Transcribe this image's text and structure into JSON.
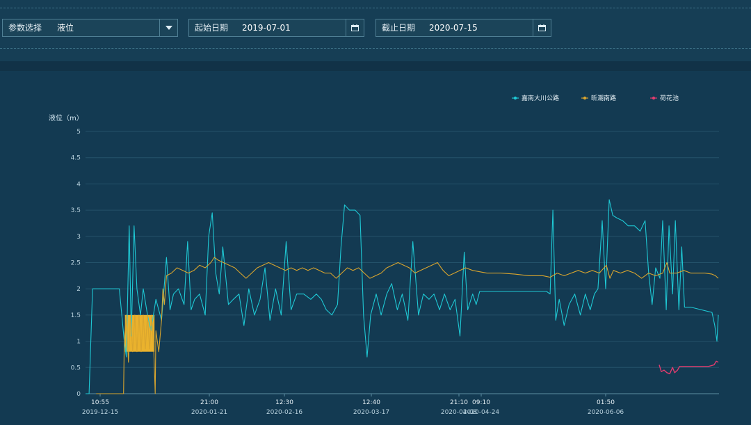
{
  "filters": {
    "param": {
      "label": "参数选择",
      "value": "液位"
    },
    "start": {
      "label": "起始日期",
      "value": "2019-07-01"
    },
    "end": {
      "label": "截止日期",
      "value": "2020-07-15"
    }
  },
  "icons": {
    "dropdown": "chevron-down-icon",
    "calendar": "calendar-icon"
  },
  "colors": {
    "page_bg": "#133a52",
    "series1": "#1fc8d4",
    "series2": "#d9a52e",
    "series3": "#e03c6e",
    "fill_block": "#f5b82b"
  },
  "chart_data": {
    "type": "line",
    "ylabel": "液位（m）",
    "ylim": [
      0,
      5
    ],
    "y_ticks": [
      "0",
      "0.5",
      "1",
      "1.5",
      "2",
      "2.5",
      "3",
      "3.5",
      "4",
      "4.5",
      "5"
    ],
    "x_ticks": [
      {
        "time": "10:55",
        "date": "2019-12-15"
      },
      {
        "time": "21:00",
        "date": "2020-01-21"
      },
      {
        "time": "12:30",
        "date": "2020-02-16"
      },
      {
        "time": "12:40",
        "date": "2020-03-17"
      },
      {
        "time": "21:10",
        "date": "2020-04-08"
      },
      {
        "time": "09:10",
        "date": "2020-04-24"
      },
      {
        "time": "01:50",
        "date": "2020-06-06"
      }
    ],
    "legend_position": "top-right",
    "grid": true,
    "series": [
      {
        "name": "嘉南大川公路",
        "color": "#1fc8d4",
        "points": [
          [
            0.0,
            0.0
          ],
          [
            0.5,
            0.0
          ],
          [
            1.0,
            2.0
          ],
          [
            2.0,
            2.0
          ],
          [
            4.8,
            2.0
          ],
          [
            5.5,
            1.0
          ],
          [
            5.8,
            0.7
          ],
          [
            6.2,
            3.2
          ],
          [
            6.5,
            1.1
          ],
          [
            6.9,
            3.2
          ],
          [
            7.3,
            2.0
          ],
          [
            7.8,
            1.5
          ],
          [
            8.2,
            2.0
          ],
          [
            8.8,
            1.5
          ],
          [
            9.3,
            1.2
          ],
          [
            10.0,
            1.8
          ],
          [
            10.8,
            1.4
          ],
          [
            11.5,
            2.6
          ],
          [
            12.0,
            1.6
          ],
          [
            12.5,
            1.9
          ],
          [
            13.2,
            2.0
          ],
          [
            14.0,
            1.7
          ],
          [
            14.5,
            2.9
          ],
          [
            15.0,
            1.6
          ],
          [
            15.5,
            1.8
          ],
          [
            16.2,
            1.9
          ],
          [
            17.0,
            1.5
          ],
          [
            17.5,
            3.0
          ],
          [
            18.0,
            3.45
          ],
          [
            18.5,
            2.3
          ],
          [
            19.0,
            1.9
          ],
          [
            19.5,
            2.8
          ],
          [
            20.3,
            1.7
          ],
          [
            21.0,
            1.8
          ],
          [
            21.8,
            1.9
          ],
          [
            22.5,
            1.3
          ],
          [
            23.2,
            2.0
          ],
          [
            24.0,
            1.5
          ],
          [
            24.8,
            1.8
          ],
          [
            25.5,
            2.4
          ],
          [
            26.2,
            1.4
          ],
          [
            27.0,
            2.0
          ],
          [
            27.8,
            1.5
          ],
          [
            28.5,
            2.9
          ],
          [
            29.2,
            1.6
          ],
          [
            30.0,
            1.9
          ],
          [
            31.0,
            1.9
          ],
          [
            32.0,
            1.8
          ],
          [
            32.8,
            1.9
          ],
          [
            33.5,
            1.8
          ],
          [
            34.2,
            1.6
          ],
          [
            35.0,
            1.5
          ],
          [
            35.8,
            1.7
          ],
          [
            36.3,
            2.8
          ],
          [
            36.8,
            3.6
          ],
          [
            37.5,
            3.5
          ],
          [
            38.3,
            3.5
          ],
          [
            39.0,
            3.4
          ],
          [
            39.5,
            1.5
          ],
          [
            40.0,
            0.7
          ],
          [
            40.5,
            1.5
          ],
          [
            41.3,
            1.9
          ],
          [
            42.0,
            1.5
          ],
          [
            42.8,
            1.9
          ],
          [
            43.5,
            2.1
          ],
          [
            44.3,
            1.6
          ],
          [
            45.0,
            1.9
          ],
          [
            45.8,
            1.4
          ],
          [
            46.5,
            2.9
          ],
          [
            47.3,
            1.5
          ],
          [
            48.0,
            1.9
          ],
          [
            48.8,
            1.8
          ],
          [
            49.5,
            1.9
          ],
          [
            50.3,
            1.6
          ],
          [
            51.0,
            1.9
          ],
          [
            51.8,
            1.6
          ],
          [
            52.5,
            1.8
          ],
          [
            53.2,
            1.1
          ],
          [
            53.8,
            2.7
          ],
          [
            54.3,
            1.6
          ],
          [
            55.0,
            1.9
          ],
          [
            55.5,
            1.7
          ],
          [
            56.0,
            1.95
          ],
          [
            58.0,
            1.95
          ],
          [
            60.0,
            1.95
          ],
          [
            62.0,
            1.95
          ],
          [
            64.0,
            1.95
          ],
          [
            65.5,
            1.95
          ],
          [
            66.0,
            1.9
          ],
          [
            66.4,
            3.5
          ],
          [
            66.8,
            1.4
          ],
          [
            67.3,
            1.8
          ],
          [
            68.0,
            1.3
          ],
          [
            68.7,
            1.7
          ],
          [
            69.5,
            1.9
          ],
          [
            70.3,
            1.5
          ],
          [
            71.0,
            1.9
          ],
          [
            71.7,
            1.6
          ],
          [
            72.3,
            1.9
          ],
          [
            72.8,
            2.0
          ],
          [
            73.4,
            3.3
          ],
          [
            73.9,
            2.0
          ],
          [
            74.4,
            3.7
          ],
          [
            74.9,
            3.4
          ],
          [
            75.5,
            3.35
          ],
          [
            76.3,
            3.3
          ],
          [
            77.1,
            3.2
          ],
          [
            78.0,
            3.2
          ],
          [
            78.8,
            3.1
          ],
          [
            79.5,
            3.3
          ],
          [
            80.0,
            2.3
          ],
          [
            80.5,
            1.7
          ],
          [
            81.0,
            2.4
          ],
          [
            81.6,
            2.2
          ],
          [
            82.0,
            3.3
          ],
          [
            82.5,
            1.6
          ],
          [
            82.9,
            3.2
          ],
          [
            83.4,
            1.9
          ],
          [
            83.8,
            3.3
          ],
          [
            84.3,
            1.6
          ],
          [
            84.7,
            2.8
          ],
          [
            85.1,
            1.65
          ],
          [
            86.0,
            1.65
          ],
          [
            87.5,
            1.6
          ],
          [
            89.0,
            1.55
          ],
          [
            89.4,
            1.3
          ],
          [
            89.7,
            1.0
          ],
          [
            89.9,
            1.5
          ]
        ]
      },
      {
        "name": "昕潮南路",
        "color": "#d9a52e",
        "points": [
          [
            1.5,
            0.0
          ],
          [
            3.5,
            0.0
          ],
          [
            5.4,
            0.0
          ],
          [
            5.5,
            1.0
          ],
          [
            5.8,
            1.5
          ],
          [
            6.1,
            0.6
          ],
          [
            6.4,
            1.5
          ],
          [
            6.7,
            0.8
          ],
          [
            7.0,
            1.5
          ],
          [
            7.3,
            0.8
          ],
          [
            7.6,
            1.5
          ],
          [
            7.9,
            0.8
          ],
          [
            8.2,
            1.5
          ],
          [
            8.5,
            0.85
          ],
          [
            8.8,
            1.5
          ],
          [
            9.1,
            0.85
          ],
          [
            9.4,
            1.5
          ],
          [
            9.7,
            0.8
          ],
          [
            9.9,
            0.0
          ],
          [
            10.0,
            1.2
          ],
          [
            10.4,
            0.8
          ],
          [
            10.8,
            1.4
          ],
          [
            11.0,
            2.0
          ],
          [
            11.2,
            1.7
          ],
          [
            11.5,
            2.25
          ],
          [
            12.2,
            2.3
          ],
          [
            13.0,
            2.4
          ],
          [
            13.8,
            2.35
          ],
          [
            14.6,
            2.3
          ],
          [
            15.4,
            2.35
          ],
          [
            16.2,
            2.45
          ],
          [
            17.0,
            2.4
          ],
          [
            17.8,
            2.5
          ],
          [
            18.3,
            2.6
          ],
          [
            18.8,
            2.55
          ],
          [
            19.6,
            2.5
          ],
          [
            20.4,
            2.45
          ],
          [
            21.2,
            2.4
          ],
          [
            22.0,
            2.3
          ],
          [
            22.8,
            2.2
          ],
          [
            23.6,
            2.3
          ],
          [
            24.4,
            2.4
          ],
          [
            25.2,
            2.45
          ],
          [
            26.0,
            2.5
          ],
          [
            26.8,
            2.45
          ],
          [
            27.6,
            2.4
          ],
          [
            28.4,
            2.35
          ],
          [
            29.2,
            2.4
          ],
          [
            30.0,
            2.35
          ],
          [
            30.8,
            2.4
          ],
          [
            31.6,
            2.35
          ],
          [
            32.4,
            2.4
          ],
          [
            33.2,
            2.35
          ],
          [
            34.0,
            2.3
          ],
          [
            34.8,
            2.3
          ],
          [
            35.6,
            2.2
          ],
          [
            36.4,
            2.3
          ],
          [
            37.2,
            2.4
          ],
          [
            38.0,
            2.35
          ],
          [
            38.8,
            2.4
          ],
          [
            39.6,
            2.3
          ],
          [
            40.4,
            2.2
          ],
          [
            41.2,
            2.25
          ],
          [
            42.0,
            2.3
          ],
          [
            42.8,
            2.4
          ],
          [
            43.6,
            2.45
          ],
          [
            44.4,
            2.5
          ],
          [
            45.2,
            2.45
          ],
          [
            46.0,
            2.4
          ],
          [
            46.8,
            2.3
          ],
          [
            47.6,
            2.35
          ],
          [
            48.4,
            2.4
          ],
          [
            49.2,
            2.45
          ],
          [
            50.0,
            2.5
          ],
          [
            50.8,
            2.35
          ],
          [
            51.6,
            2.25
          ],
          [
            52.4,
            2.3
          ],
          [
            53.2,
            2.35
          ],
          [
            54.0,
            2.4
          ],
          [
            55.0,
            2.35
          ],
          [
            57.0,
            2.3
          ],
          [
            59.0,
            2.3
          ],
          [
            61.0,
            2.28
          ],
          [
            63.0,
            2.25
          ],
          [
            65.0,
            2.25
          ],
          [
            66.0,
            2.22
          ],
          [
            67.0,
            2.3
          ],
          [
            68.0,
            2.25
          ],
          [
            69.0,
            2.3
          ],
          [
            70.0,
            2.35
          ],
          [
            71.0,
            2.3
          ],
          [
            72.0,
            2.35
          ],
          [
            73.0,
            2.3
          ],
          [
            74.0,
            2.45
          ],
          [
            74.5,
            2.2
          ],
          [
            75.0,
            2.35
          ],
          [
            76.0,
            2.3
          ],
          [
            77.0,
            2.35
          ],
          [
            78.0,
            2.3
          ],
          [
            79.0,
            2.2
          ],
          [
            80.0,
            2.3
          ],
          [
            81.0,
            2.25
          ],
          [
            82.0,
            2.3
          ],
          [
            82.6,
            2.5
          ],
          [
            83.0,
            2.3
          ],
          [
            84.0,
            2.3
          ],
          [
            85.0,
            2.35
          ],
          [
            86.0,
            2.3
          ],
          [
            87.0,
            2.3
          ],
          [
            88.0,
            2.3
          ],
          [
            89.0,
            2.28
          ],
          [
            89.5,
            2.25
          ],
          [
            89.9,
            2.2
          ]
        ]
      },
      {
        "name": "荷花池",
        "color": "#e03c6e",
        "points": [
          [
            81.5,
            0.55
          ],
          [
            81.8,
            0.42
          ],
          [
            82.2,
            0.45
          ],
          [
            82.6,
            0.4
          ],
          [
            83.0,
            0.38
          ],
          [
            83.4,
            0.5
          ],
          [
            83.7,
            0.4
          ],
          [
            84.1,
            0.45
          ],
          [
            84.4,
            0.52
          ],
          [
            85.5,
            0.52
          ],
          [
            87.0,
            0.52
          ],
          [
            88.5,
            0.52
          ],
          [
            89.3,
            0.55
          ],
          [
            89.6,
            0.62
          ],
          [
            89.9,
            0.6
          ]
        ]
      }
    ]
  }
}
